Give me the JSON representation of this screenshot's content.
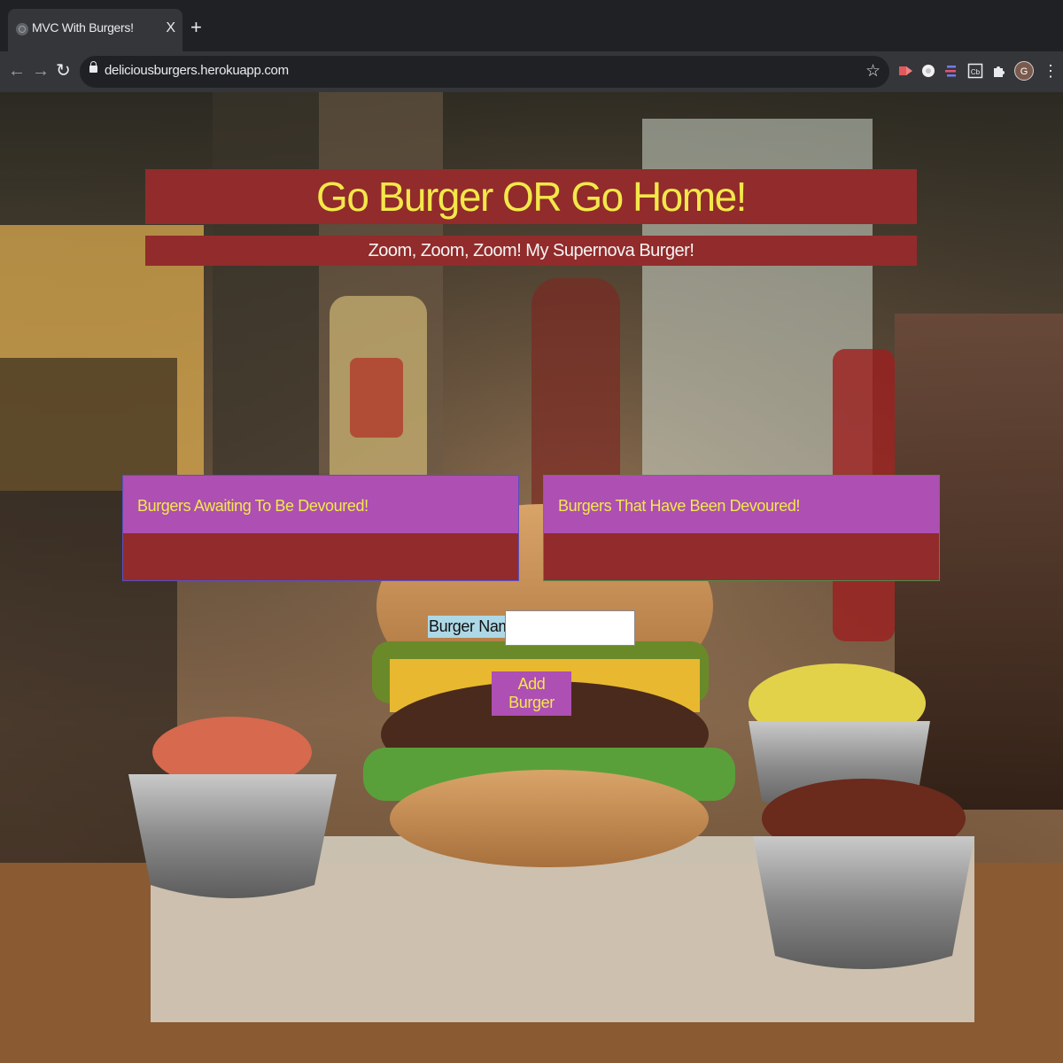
{
  "browser": {
    "tab_title": "MVC With Burgers!",
    "tab_close": "X",
    "new_tab": "+",
    "url": "deliciousburgers.herokuapp.com",
    "profile_initial": "G",
    "extension_label": "Cb"
  },
  "page": {
    "heading": "Go Burger OR Go Home!",
    "subheading": "Zoom, Zoom, Zoom! My Supernova Burger!",
    "panels": [
      {
        "title": "Burgers Awaiting To Be Devoured!"
      },
      {
        "title": "Burgers That Have Been Devoured!"
      }
    ],
    "form": {
      "label": "Burger Name:",
      "input_value": "",
      "submit_label": "Add Burger"
    }
  },
  "colors": {
    "banner_bg": "#922b2b",
    "heading_text": "#f2e84a",
    "panel_header_bg": "#ad4fb3",
    "label_bg": "#add8e6"
  }
}
